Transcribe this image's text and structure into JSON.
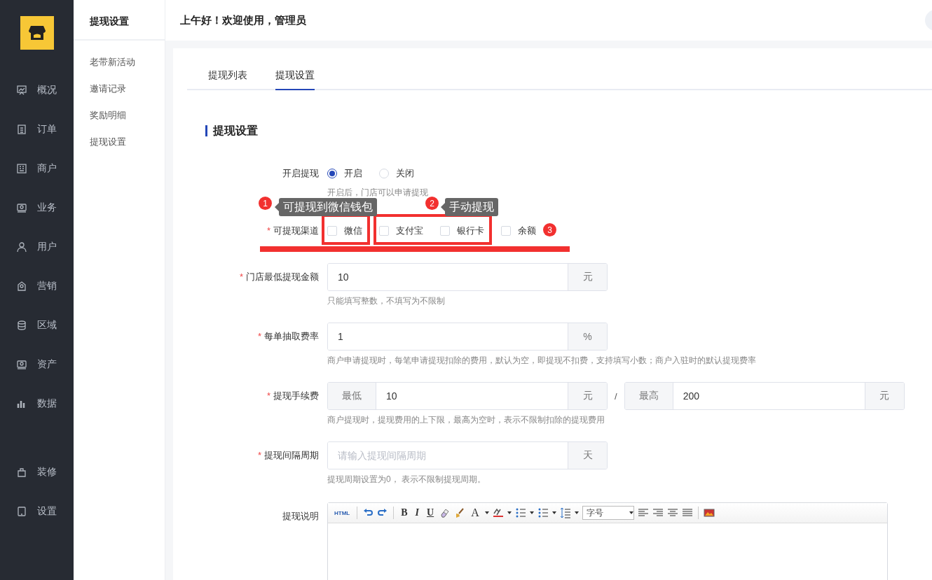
{
  "sidebar": {
    "items": [
      {
        "label": "概况",
        "selected": false
      },
      {
        "label": "订单",
        "selected": false
      },
      {
        "label": "商户",
        "selected": false
      },
      {
        "label": "业务",
        "selected": false
      },
      {
        "label": "用户",
        "selected": false
      },
      {
        "label": "营销",
        "selected": false
      },
      {
        "label": "区域",
        "selected": false
      },
      {
        "label": "资产",
        "selected": false
      },
      {
        "label": "数据",
        "selected": false
      },
      {
        "label": "装修",
        "selected": false
      },
      {
        "label": "设置",
        "selected": false
      }
    ]
  },
  "subnav": {
    "title": "提现设置",
    "items": [
      {
        "label": "老带新活动"
      },
      {
        "label": "邀请记录"
      },
      {
        "label": "奖励明细"
      },
      {
        "label": "提现设置"
      }
    ]
  },
  "header": {
    "greeting": "上午好！欢迎使用，管理员"
  },
  "tabs": [
    {
      "label": "提现列表",
      "selected": false
    },
    {
      "label": "提现设置",
      "selected": true
    }
  ],
  "section_title": "提现设置",
  "form": {
    "enable": {
      "label": "开启提现",
      "options": [
        {
          "label": "开启",
          "selected": true
        },
        {
          "label": "关闭",
          "selected": false
        }
      ],
      "hint": "开启后，门店可以申请提现"
    },
    "channels": {
      "label": "可提现渠道",
      "required_mark": "*",
      "options": [
        {
          "label": "微信",
          "checked": false
        },
        {
          "label": "支付宝",
          "checked": false
        },
        {
          "label": "银行卡",
          "checked": false
        },
        {
          "label": "余额",
          "checked": false
        }
      ]
    },
    "fields": [
      {
        "kind": "suffix",
        "label": "门店最低提现金额",
        "required_mark": "*",
        "value": "10",
        "suffix": "元",
        "hint": "只能填写整数，不填写为不限制"
      },
      {
        "kind": "suffix",
        "label": "每单抽取费率",
        "required_mark": "*",
        "value": "1",
        "suffix": "%",
        "hint": "商户申请提现时，每笔申请提现扣除的费用，默认为空，即提现不扣费，支持填写小数；商户入驻时的默认提现费率"
      },
      {
        "kind": "range",
        "label": "提现手续费",
        "required_mark": "*",
        "min_prefix": "最低",
        "min_value": "10",
        "min_suffix": "元",
        "separator": "/",
        "max_prefix": "最高",
        "max_value": "200",
        "max_suffix": "元",
        "hint": "商户提现时，提现费用的上下限，最高为空时，表示不限制扣除的提现费用"
      },
      {
        "kind": "suffix",
        "label": "提现间隔周期",
        "required_mark": "*",
        "placeholder": "请输入提现间隔周期",
        "suffix": "天",
        "hint": "提现周期设置为0， 表示不限制提现周期。"
      }
    ],
    "editor": {
      "label": "提现说明",
      "html_label": "HTML",
      "bold": "B",
      "italic": "I",
      "underline": "U",
      "font_color": "A",
      "font_size": "字号"
    }
  },
  "annotations": {
    "tooltips": [
      {
        "number": "1",
        "text": "可提现到微信钱包"
      },
      {
        "number": "2",
        "text": "手动提现"
      }
    ],
    "badge": "3"
  }
}
